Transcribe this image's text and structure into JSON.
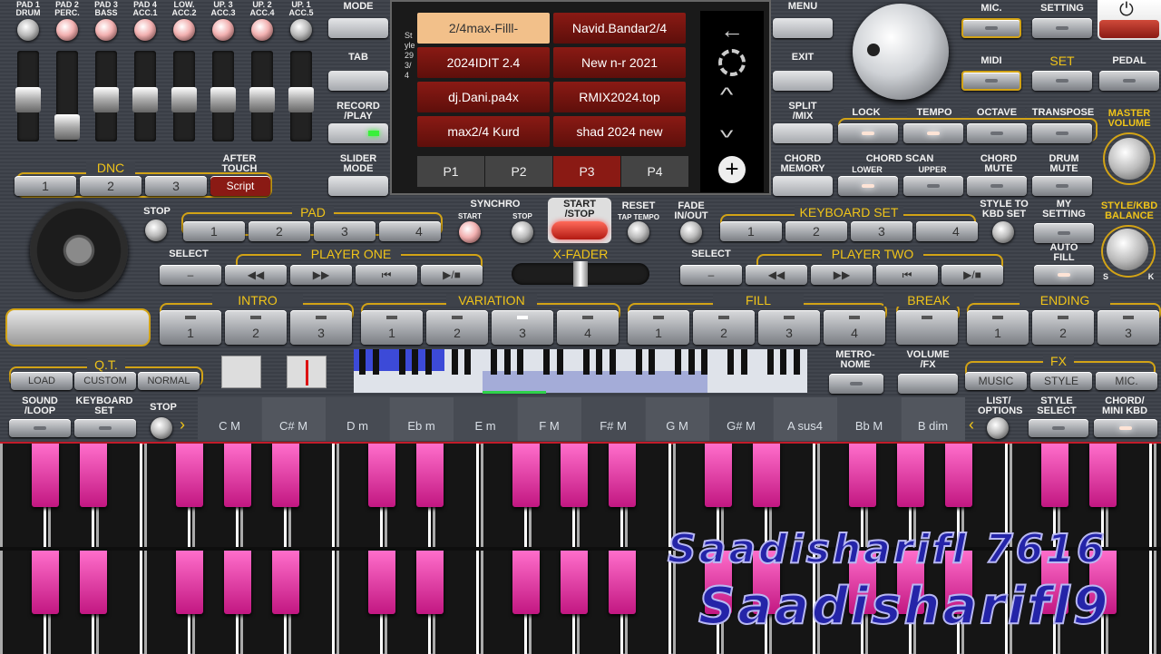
{
  "channels": {
    "top": [
      "PAD 1",
      "PAD 2",
      "PAD 3",
      "PAD 4",
      "LOW.",
      "UP. 3",
      "UP. 2",
      "UP. 1"
    ],
    "bottom": [
      "DRUM",
      "PERC.",
      "BASS",
      "ACC.1",
      "ACC.2",
      "ACC.3",
      "ACC.4",
      "ACC.5"
    ]
  },
  "left": {
    "dnc": "DNC",
    "after_touch": "AFTER\nTOUCH",
    "dnc_buttons": [
      "1",
      "2",
      "3"
    ],
    "script": "Script",
    "stop": "STOP",
    "pad": "PAD",
    "pad_buttons": [
      "1",
      "2",
      "3",
      "4"
    ],
    "select": "SELECT",
    "player_one": "PLAYER ONE"
  },
  "center": {
    "mode": "MODE",
    "tab": "TAB",
    "record": "RECORD\n/PLAY",
    "slider": "SLIDER\nMODE",
    "menu": "MENU",
    "exit": "EXIT",
    "split": "SPLIT\n/MIX",
    "chord_memory": "CHORD\nMEMORY",
    "style_vert": "Style 29 3/4"
  },
  "styles": [
    [
      "2/4max-Filll-",
      "Navid.Bandar2/4"
    ],
    [
      "2024IDIT 2.4",
      "New n-r 2021"
    ],
    [
      "dj.Dani.pa4x",
      "RMIX2024.top"
    ],
    [
      "max2/4 Kurd",
      "shad 2024 new"
    ]
  ],
  "pages": [
    "P1",
    "P2",
    "P3",
    "P4"
  ],
  "transport": {
    "synchro": "SYNCHRO",
    "start": "START",
    "stop": "STOP",
    "start_stop": "START\n/STOP",
    "reset": "RESET",
    "tap": "TAP TEMPO",
    "fade": "FADE\nIN/OUT",
    "xfader": "X-FADER"
  },
  "right": {
    "mic": "MIC.",
    "setting": "SETTING",
    "midi": "MIDI",
    "set": "SET",
    "pedal": "PEDAL",
    "lock": "LOCK",
    "tempo": "TEMPO",
    "octave": "OCTAVE",
    "transpose": "TRANSPOSE",
    "master": "MASTER\nVOLUME",
    "chord_scan": "CHORD SCAN",
    "lower": "LOWER",
    "upper": "UPPER",
    "chord_mute": "CHORD\nMUTE",
    "drum_mute": "DRUM\nMUTE",
    "style_kbd_bal": "STYLE/KBD\nBALANCE",
    "keyboard_set": "KEYBOARD SET",
    "kbd_buttons": [
      "1",
      "2",
      "3",
      "4"
    ],
    "style_to_kbd": "STYLE TO\nKBD SET",
    "my_setting": "MY\nSETTING",
    "auto_fill": "AUTO\nFILL",
    "select": "SELECT",
    "player_two": "PLAYER TWO",
    "s": "S",
    "k": "K"
  },
  "sections": {
    "intro": "INTRO",
    "variation": "VARIATION",
    "fill": "FILL",
    "break": "BREAK",
    "ending": "ENDING"
  },
  "bottom": {
    "qt": "Q.T.",
    "load": "LOAD",
    "custom": "CUSTOM",
    "normal": "NORMAL",
    "metronome": "METRO-\nNOME",
    "volume_fx": "VOLUME\n/FX",
    "fx": "FX",
    "music": "MUSIC",
    "style": "STYLE",
    "mic": "MIC.",
    "sound_loop": "SOUND\n/LOOP",
    "keyboard_set": "KEYBOARD\nSET",
    "stop": "STOP",
    "list_options": "LIST/\nOPTIONS",
    "style_select": "STYLE\nSELECT",
    "chord_mini": "CHORD/\nMINI KBD"
  },
  "chords": [
    "C M",
    "C# M",
    "D m",
    "Eb m",
    "E m",
    "F M",
    "F# M",
    "G M",
    "G# M",
    "A sus4",
    "Bb M",
    "B dim"
  ],
  "watermark": {
    "line1": "Saadisharifl 7616",
    "line2": "Saadisharifl9"
  },
  "colors": {
    "accent": "#f0c419",
    "red": "#8a1a14",
    "pink": "#e0309a"
  }
}
